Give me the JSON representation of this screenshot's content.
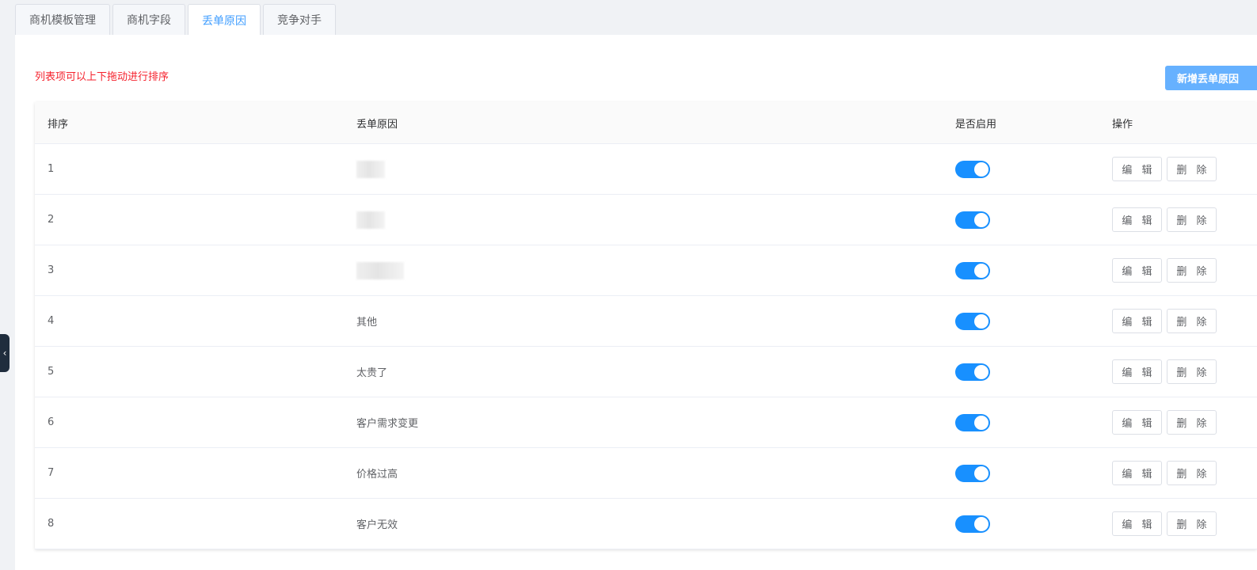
{
  "tabs": [
    {
      "label": "商机模板管理",
      "active": false
    },
    {
      "label": "商机字段",
      "active": false
    },
    {
      "label": "丢单原因",
      "active": true
    },
    {
      "label": "竞争对手",
      "active": false
    }
  ],
  "hint": "列表项可以上下拖动进行排序",
  "add_button": "新增丢单原因",
  "table": {
    "headers": {
      "order": "排序",
      "reason": "丢单原因",
      "enabled": "是否启用",
      "actions": "操作"
    },
    "edit_label": "编 辑",
    "delete_label": "删 除",
    "rows": [
      {
        "order": "1",
        "reason": "",
        "enabled": true
      },
      {
        "order": "2",
        "reason": "",
        "enabled": true
      },
      {
        "order": "3",
        "reason": "",
        "enabled": true
      },
      {
        "order": "4",
        "reason": "其他",
        "enabled": true
      },
      {
        "order": "5",
        "reason": "太贵了",
        "enabled": true
      },
      {
        "order": "6",
        "reason": "客户需求变更",
        "enabled": true
      },
      {
        "order": "7",
        "reason": "价格过高",
        "enabled": true
      },
      {
        "order": "8",
        "reason": "客户无效",
        "enabled": true
      }
    ]
  },
  "colors": {
    "accent": "#409eff",
    "switch_on": "#1890ff",
    "hint": "#f5222d"
  },
  "collapse_icon": "chevron-left-icon"
}
